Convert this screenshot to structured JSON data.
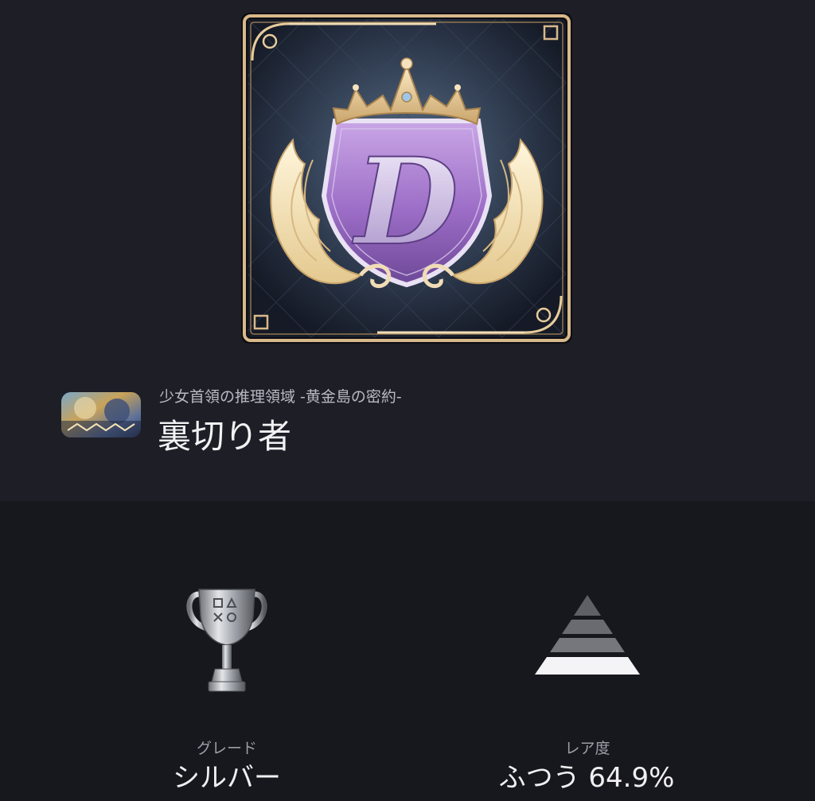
{
  "trophy": {
    "game_title": "少女首領の推理領域 -黄金島の密約-",
    "name": "裏切り者",
    "emblem_letter": "D",
    "art_icon": "winged-crown-crest-icon"
  },
  "game": {
    "icon": "game-cover-icon"
  },
  "stats": {
    "grade_label": "グレード",
    "grade_value": "シルバー",
    "grade_icon": "silver-trophy-icon",
    "rarity_label": "レア度",
    "rarity_value": "ふつう 64.9%",
    "rarity_icon": "rarity-pyramid-icon"
  },
  "colors": {
    "background_top": "#1e1e27",
    "background_bottom": "#17171e",
    "frame_gold": "#d8b98a",
    "shield_purple": "#a97dd0",
    "silver": "#b9bcc2"
  }
}
